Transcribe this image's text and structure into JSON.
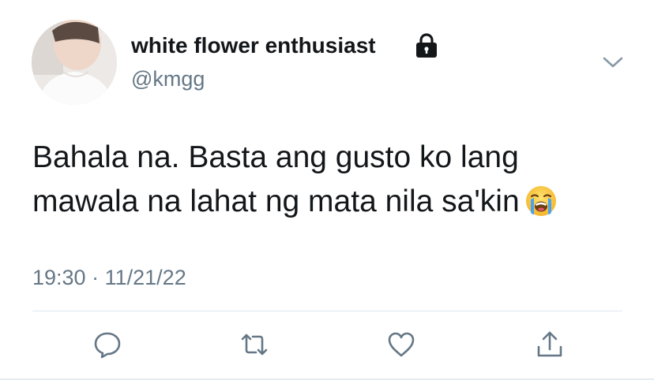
{
  "tweet": {
    "display_name": "white flower enthusiast",
    "handle": "@kmgg",
    "text_lines": [
      "Bahala na. Basta ang gusto ko lang",
      "mawala na lahat ng mata nila sa'kin"
    ],
    "emoji": "loudly-crying-face",
    "time": "19:30",
    "separator": "·",
    "date": "11/21/22",
    "protected_account": true
  },
  "actions": [
    {
      "name": "reply",
      "icon": "speech-bubble-icon"
    },
    {
      "name": "retweet",
      "icon": "retweet-arrows-icon"
    },
    {
      "name": "like",
      "icon": "heart-outline-icon"
    },
    {
      "name": "share",
      "icon": "share-upload-icon"
    }
  ],
  "colors": {
    "text": "#14171a",
    "secondary_text": "#657786",
    "icon": "#657786",
    "divider": "#e1e8ed",
    "background": "#ffffff"
  }
}
